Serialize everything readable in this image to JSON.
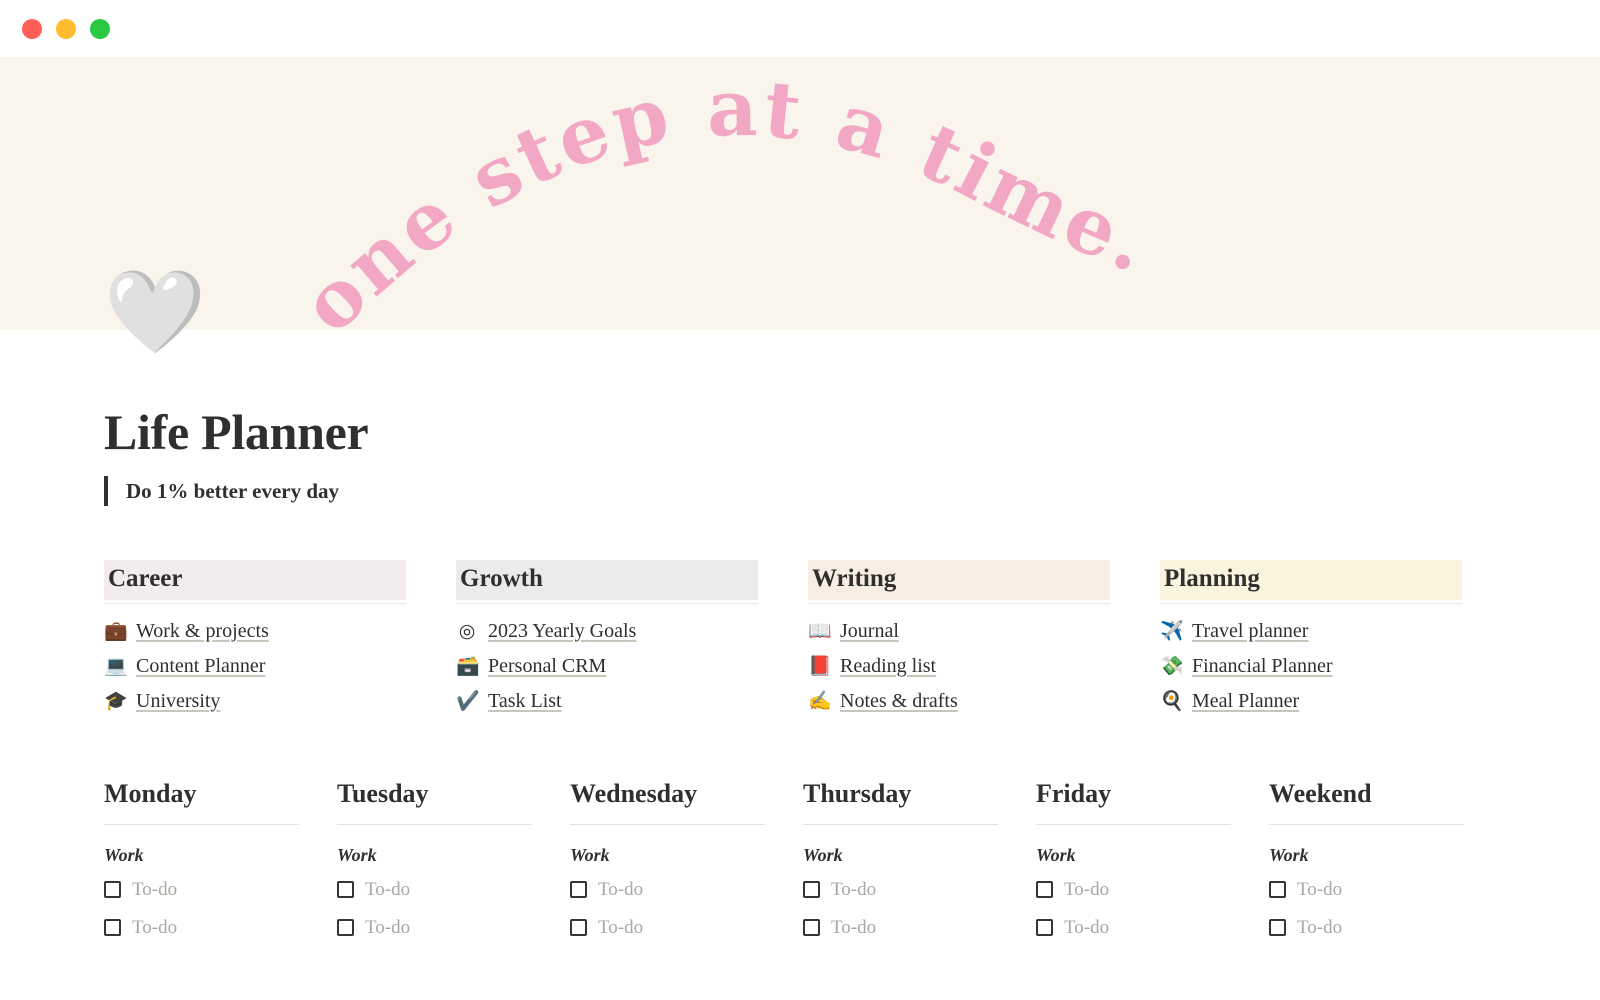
{
  "window": {
    "controls": [
      {
        "name": "close",
        "color": "#ff5f57"
      },
      {
        "name": "minimize",
        "color": "#febc2e"
      },
      {
        "name": "maximize",
        "color": "#28c840"
      }
    ]
  },
  "cover": {
    "background": "#f9f5ec",
    "banner_text": "one step at a time.",
    "banner_color": "#f2a8c4",
    "banner_words": [
      "one",
      "step",
      "at",
      "a",
      "time."
    ]
  },
  "page": {
    "icon": "🤍",
    "icon_name": "white-heart-emoji",
    "title": "Life Planner",
    "callout": "Do 1% better every day"
  },
  "categories": [
    {
      "title": "Career",
      "accent": "#f2edec",
      "items": [
        {
          "emoji": "💼",
          "icon_name": "briefcase-icon",
          "label": "Work & projects"
        },
        {
          "emoji": "💻",
          "icon_name": "laptop-icon",
          "label": "Content Planner"
        },
        {
          "emoji": "🎓",
          "icon_name": "graduation-cap-icon",
          "label": "University"
        }
      ]
    },
    {
      "title": "Growth",
      "accent": "#eceaea",
      "items": [
        {
          "emoji": "◎",
          "icon_name": "target-icon",
          "label": "2023 Yearly Goals"
        },
        {
          "emoji": "🗃️",
          "icon_name": "card-file-box-icon",
          "label": "Personal CRM"
        },
        {
          "emoji": "✔️",
          "icon_name": "check-mark-icon",
          "label": "Task List"
        }
      ]
    },
    {
      "title": "Writing",
      "accent": "#f7ede2",
      "items": [
        {
          "emoji": "📖",
          "icon_name": "open-book-icon",
          "label": "Journal"
        },
        {
          "emoji": "📕",
          "icon_name": "closed-book-icon",
          "label": "Reading list"
        },
        {
          "emoji": "✍️",
          "icon_name": "writing-hand-icon",
          "label": "Notes & drafts"
        }
      ]
    },
    {
      "title": "Planning",
      "accent": "#faf3dd",
      "items": [
        {
          "emoji": "✈️",
          "icon_name": "airplane-icon",
          "label": "Travel planner"
        },
        {
          "emoji": "💸",
          "icon_name": "money-with-wings-icon",
          "label": "Financial Planner"
        },
        {
          "emoji": "🍳",
          "icon_name": "cooking-icon",
          "label": "Meal Planner"
        }
      ]
    }
  ],
  "week": {
    "section_label": "Work",
    "todo_label": "To-do",
    "days": [
      {
        "name": "Monday",
        "todos": [
          "To-do",
          "To-do"
        ]
      },
      {
        "name": "Tuesday",
        "todos": [
          "To-do",
          "To-do"
        ]
      },
      {
        "name": "Wednesday",
        "todos": [
          "To-do",
          "To-do"
        ]
      },
      {
        "name": "Thursday",
        "todos": [
          "To-do",
          "To-do"
        ]
      },
      {
        "name": "Friday",
        "todos": [
          "To-do",
          "To-do"
        ]
      },
      {
        "name": "Weekend",
        "todos": [
          "To-do",
          "To-do"
        ]
      }
    ]
  }
}
